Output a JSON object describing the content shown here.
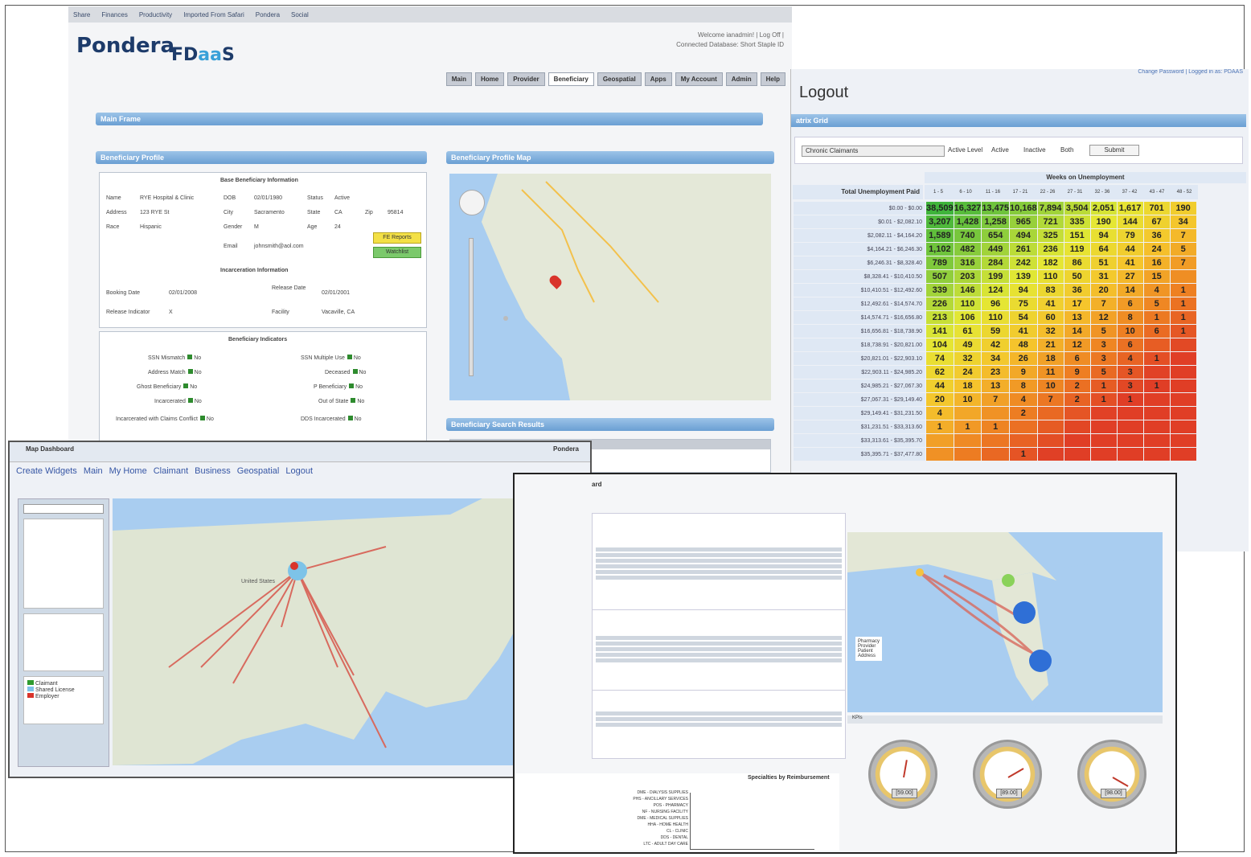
{
  "main": {
    "bookmarks": [
      "Share",
      "Finances",
      "Productivity",
      "Imported From Safari",
      "Pondera",
      "Social"
    ],
    "logo": "Pondera",
    "logo2_a": "FD",
    "logo2_b": "aa",
    "logo2_c": "S",
    "welcome_line1": "Welcome ianadmin! | Log Off |",
    "welcome_line2": "Connected Database: Short Staple ID",
    "tabs": [
      "Main",
      "Home",
      "Provider",
      "Beneficiary",
      "Geospatial",
      "Apps",
      "My Account",
      "Admin",
      "Help"
    ],
    "main_frame": "Main Frame",
    "profile_title": "Beneficiary Profile",
    "profile_map_title": "Beneficiary Profile Map",
    "base_info": "Base Beneficiary Information",
    "fields": {
      "name_label": "Name",
      "name_val": "RYE Hospital & Clinic",
      "address_label": "Address",
      "address_val": "123 RYE St",
      "race_label": "Race",
      "race_val": "Hispanic",
      "dob_label": "DOB",
      "dob_val": "02/01/1980",
      "city_label": "City",
      "city_val": "Sacramento",
      "gender_label": "Gender",
      "gender_val": "M",
      "email_label": "Email",
      "email_val": "johnsmith@aol.com",
      "status_label": "Status",
      "status_val": "Active",
      "state_label": "State",
      "state_val": "CA",
      "age_label": "Age",
      "age_val": "24",
      "zip_label": "Zip",
      "zip_val": "95814"
    },
    "fe_button": "FE Reports",
    "watchlist_button": "Watchlist",
    "incarceration_info": "Incarceration Information",
    "booking_label": "Booking Date",
    "booking_val": "02/01/2008",
    "release_label": "Release Date",
    "release_val": "02/01/2001",
    "release_ind_label": "Release Indicator",
    "release_ind_val": "X",
    "facility_label": "Facility",
    "facility_val": "Vacaville, CA",
    "indicators_title": "Beneficiary Indicators",
    "indicators_left": [
      "SSN Mismatch",
      "Address Match",
      "Ghost Beneficiary",
      "Incarcerated",
      "Incarcerated with Claims Conflict"
    ],
    "indicators_right": [
      "SSN Multiple Use",
      "Deceased",
      "P Beneficiary",
      "Out of State",
      "DDS Incarcerated"
    ],
    "indicator_value": "No",
    "search_results_title": "Beneficiary Search Results"
  },
  "heat": {
    "top_links": "Change Password | Logged in as: PDAAS",
    "title": "Logout",
    "grid_title": "atrix Grid",
    "select_value": "Chronic Claimants",
    "active_level": "Active Level",
    "radio_options": [
      "Active",
      "Inactive",
      "Both"
    ],
    "submit": "Submit",
    "weeks_header": "Weeks on Unemployment",
    "paid_header": "Total Unemployment Paid",
    "week_cols": [
      "1 - 5",
      "6 - 10",
      "11 - 16",
      "17 - 21",
      "22 - 26",
      "27 - 31",
      "32 - 36",
      "37 - 42",
      "43 - 47",
      "48 - 52"
    ],
    "row_labels": [
      "$0.00 - $0.00",
      "$0.01 - $2,082.10",
      "$2,082.11 - $4,164.20",
      "$4,164.21 - $6,246.30",
      "$6,246.31 - $8,328.40",
      "$8,328.41 - $10,410.50",
      "$10,410.51 - $12,492.60",
      "$12,492.61 - $14,574.70",
      "$14,574.71 - $16,656.80",
      "$16,656.81 - $18,738.90",
      "$18,738.91 - $20,821.00",
      "$20,821.01 - $22,903.10",
      "$22,903.11 - $24,985.20",
      "$24,985.21 - $27,067.30",
      "$27,067.31 - $29,149.40",
      "$29,149.41 - $31,231.50",
      "$31,231.51 - $33,313.60",
      "$33,313.61 - $35,395.70",
      "$35,395.71 - $37,477.80"
    ],
    "rows": [
      [
        "38,509",
        "16,327",
        "13,475",
        "10,168",
        "7,894",
        "3,504",
        "2,051",
        "1,617",
        "701",
        "190"
      ],
      [
        "3,207",
        "1,428",
        "1,258",
        "965",
        "721",
        "335",
        "190",
        "144",
        "67",
        "34"
      ],
      [
        "1,589",
        "740",
        "654",
        "494",
        "325",
        "151",
        "94",
        "79",
        "36",
        "7"
      ],
      [
        "1,102",
        "482",
        "449",
        "261",
        "236",
        "119",
        "64",
        "44",
        "24",
        "5"
      ],
      [
        "789",
        "316",
        "284",
        "242",
        "182",
        "86",
        "51",
        "41",
        "16",
        "7"
      ],
      [
        "507",
        "203",
        "199",
        "139",
        "110",
        "50",
        "31",
        "27",
        "15",
        ""
      ],
      [
        "339",
        "146",
        "124",
        "94",
        "83",
        "36",
        "20",
        "14",
        "4",
        "1"
      ],
      [
        "226",
        "110",
        "96",
        "75",
        "41",
        "17",
        "7",
        "6",
        "5",
        "1"
      ],
      [
        "213",
        "106",
        "110",
        "54",
        "60",
        "13",
        "12",
        "8",
        "1",
        "1"
      ],
      [
        "141",
        "61",
        "59",
        "41",
        "32",
        "14",
        "5",
        "10",
        "6",
        "1"
      ],
      [
        "104",
        "49",
        "42",
        "48",
        "21",
        "12",
        "3",
        "6",
        "",
        ""
      ],
      [
        "74",
        "32",
        "34",
        "26",
        "18",
        "6",
        "3",
        "4",
        "1",
        ""
      ],
      [
        "62",
        "24",
        "23",
        "9",
        "11",
        "9",
        "5",
        "3",
        "",
        ""
      ],
      [
        "44",
        "18",
        "13",
        "8",
        "10",
        "2",
        "1",
        "3",
        "1",
        ""
      ],
      [
        "20",
        "10",
        "7",
        "4",
        "7",
        "2",
        "1",
        "1",
        "",
        ""
      ],
      [
        "4",
        "",
        "",
        "2",
        "",
        "",
        "",
        "",
        "",
        ""
      ],
      [
        "1",
        "1",
        "1",
        "",
        "",
        "",
        "",
        "",
        "",
        ""
      ],
      [
        "",
        "",
        "",
        "",
        "",
        "",
        "",
        "",
        "",
        ""
      ],
      [
        "",
        "",
        "",
        "1",
        "",
        "",
        "",
        "",
        "",
        ""
      ]
    ]
  },
  "bl": {
    "title": "Map Dashboard",
    "brand": "Pondera",
    "menu": [
      "Create Widgets",
      "Main",
      "My Home",
      "Claimant",
      "Business",
      "Geospatial",
      "Logout"
    ],
    "label_country": "United States",
    "legend": [
      "Claimant",
      "Shared License",
      "Employer"
    ]
  },
  "br": {
    "title": "ard",
    "legend": [
      "Pharmacy",
      "Provider",
      "Patient",
      "Address"
    ],
    "kpi_title": "KPIs",
    "gauge_values": [
      "[59.00]",
      "[89.00]",
      "[98.00]"
    ],
    "chart_title": "Specialties by Reimbursement",
    "chart_labels": [
      "DME - DIALYSIS SUPPLIES",
      "PHS - ANCILLARY SERVICES",
      "POS - PHARMACY",
      "NF - NURSING FACILITY",
      "DME - MEDICAL SUPPLIES",
      "HHA - HOME HEALTH",
      "CL - CLINIC",
      "DDS - DENTAL",
      "LTC - ADULT DAY CARE"
    ]
  }
}
